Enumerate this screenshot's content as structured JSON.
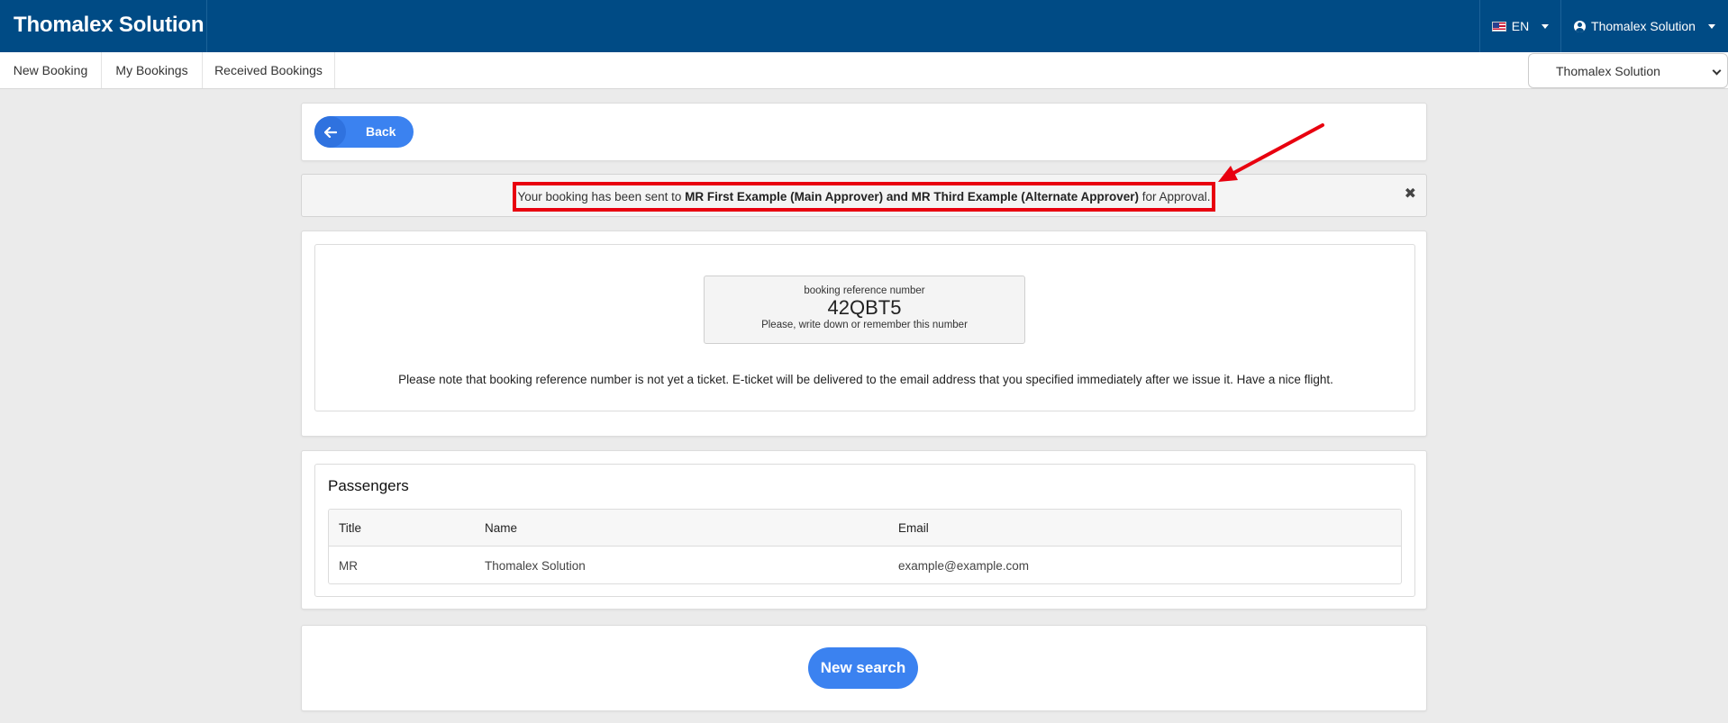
{
  "header": {
    "brand": "Thomalex Solution",
    "language": {
      "code": "EN",
      "icon": "us-flag-icon"
    },
    "user": {
      "name": "Thomalex Solution",
      "icon": "user-circle-icon"
    }
  },
  "nav": {
    "items": [
      {
        "label": "New Booking"
      },
      {
        "label": "My Bookings"
      },
      {
        "label": "Received Bookings"
      }
    ],
    "organization_select": {
      "value": "Thomalex Solution"
    }
  },
  "back_button": {
    "label": "Back",
    "icon": "arrow-left-icon"
  },
  "alert": {
    "prefix": "Your booking has been sent to ",
    "approvers": "MR First Example (Main Approver) and MR Third Example (Alternate Approver)",
    "suffix": " for Approval.",
    "close_symbol": "✖",
    "highlight_color": "#e8000f"
  },
  "booking": {
    "reference_caption": "booking reference number",
    "reference_number": "42QBT5",
    "reference_hint": "Please, write down or remember this number",
    "note": "Please note that booking reference number is not yet a ticket. E-ticket will be delivered to the email address that you specified immediately after we issue it. Have a nice flight."
  },
  "passengers": {
    "title": "Passengers",
    "columns": [
      "Title",
      "Name",
      "Email"
    ],
    "rows": [
      [
        "MR",
        "Thomalex Solution",
        "example@example.com"
      ]
    ]
  },
  "new_search_button": {
    "label": "New search"
  },
  "colors": {
    "header_bg": "#004b85",
    "accent_blue": "#3b82f0",
    "annotation_red": "#e8000f"
  }
}
